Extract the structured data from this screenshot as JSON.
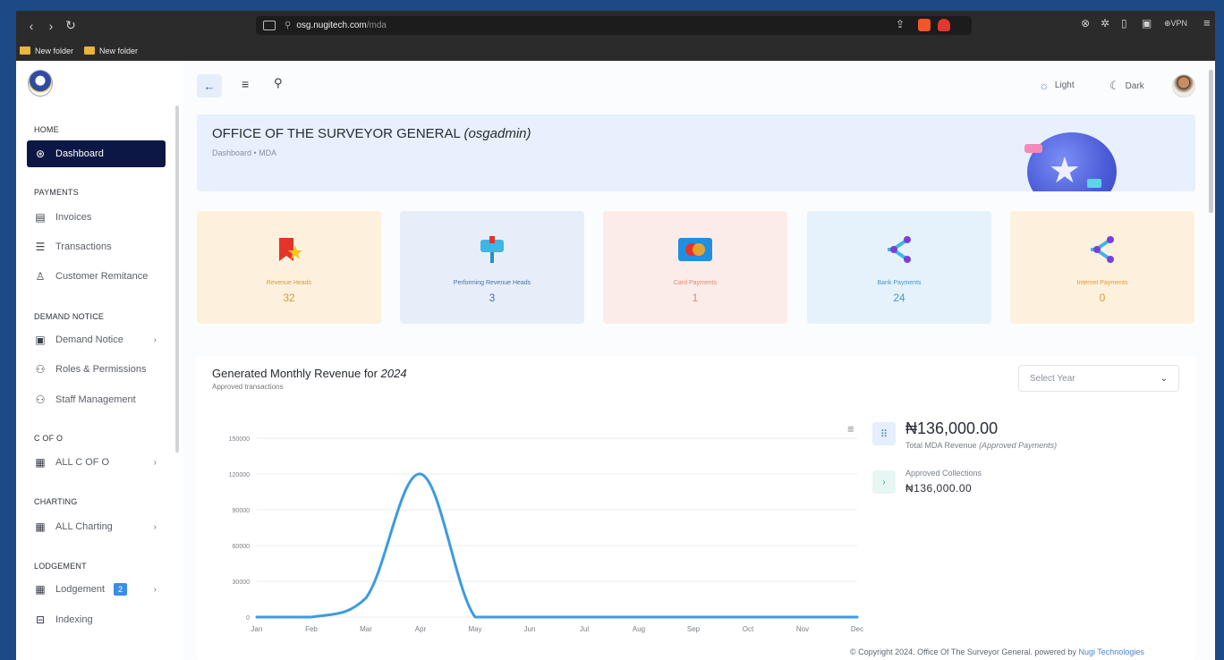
{
  "browser": {
    "url_host": "osg.nugitech.com",
    "url_path": "/mda",
    "vpn_label": "VPN",
    "bookmarks": [
      "New folder",
      "New folder"
    ]
  },
  "sidebar": {
    "sections": [
      {
        "title": "HOME",
        "items": [
          {
            "label": "Dashboard",
            "icon": "dashboard-icon",
            "active": true
          }
        ]
      },
      {
        "title": "PAYMENTS",
        "items": [
          {
            "label": "Invoices",
            "icon": "invoice-icon"
          },
          {
            "label": "Transactions",
            "icon": "transactions-icon"
          },
          {
            "label": "Customer Remitance",
            "icon": "user-icon"
          }
        ]
      },
      {
        "title": "DEMAND NOTICE",
        "items": [
          {
            "label": "Demand Notice",
            "icon": "clipboard-icon",
            "chevron": true
          },
          {
            "label": "Roles & Permissions",
            "icon": "users-icon"
          },
          {
            "label": "Staff Management",
            "icon": "users-icon"
          }
        ]
      },
      {
        "title": "C OF O",
        "items": [
          {
            "label": "ALL C OF O",
            "icon": "grid-icon",
            "chevron": true
          }
        ]
      },
      {
        "title": "CHARTING",
        "items": [
          {
            "label": "ALL Charting",
            "icon": "grid-icon",
            "chevron": true
          }
        ]
      },
      {
        "title": "LODGEMENT",
        "items": [
          {
            "label": "Lodgement",
            "icon": "grid-icon",
            "chevron": true,
            "badge": "2"
          },
          {
            "label": "Indexing",
            "icon": "archive-icon"
          }
        ]
      }
    ]
  },
  "header": {
    "light_label": "Light",
    "dark_label": "Dark"
  },
  "banner": {
    "title": "OFFICE OF THE SURVEYOR GENERAL",
    "title_user": "(osgadmin)",
    "breadcrumb": "Dashboard  •  MDA"
  },
  "cards": [
    {
      "label": "Revenue Heads",
      "value": "32"
    },
    {
      "label": "Performing Revenue Heads",
      "value": "3"
    },
    {
      "label": "Card Payments",
      "value": "1"
    },
    {
      "label": "Bank Payments",
      "value": "24"
    },
    {
      "label": "Internet Payments",
      "value": "0"
    }
  ],
  "revenue_panel": {
    "title": "Generated Monthly Revenue for",
    "year": "2024",
    "subtitle": "Approved transactions",
    "select_placeholder": "Select Year",
    "total_amount": "₦136,000.00",
    "total_label": "Total MDA Revenue",
    "total_label_note": "(Approved Payments)",
    "approved_label": "Approved Collections",
    "approved_amount": "₦136,000.00"
  },
  "chart_data": {
    "type": "line",
    "categories": [
      "Jan",
      "Feb",
      "Mar",
      "Apr",
      "May",
      "Jun",
      "Jul",
      "Aug",
      "Sep",
      "Oct",
      "Nov",
      "Dec"
    ],
    "values": [
      0,
      0,
      16000,
      120000,
      0,
      0,
      0,
      0,
      0,
      0,
      0,
      0
    ],
    "yticks": [
      "0",
      "30000",
      "60000",
      "90000",
      "120000",
      "150000"
    ],
    "ylim": [
      0,
      150000
    ],
    "grid": true,
    "color": "#3b9be3"
  },
  "footer": {
    "copyright": "© Copyright 2024. Office Of The Surveyor General. powered by",
    "brand": "Nugi Technologies"
  }
}
